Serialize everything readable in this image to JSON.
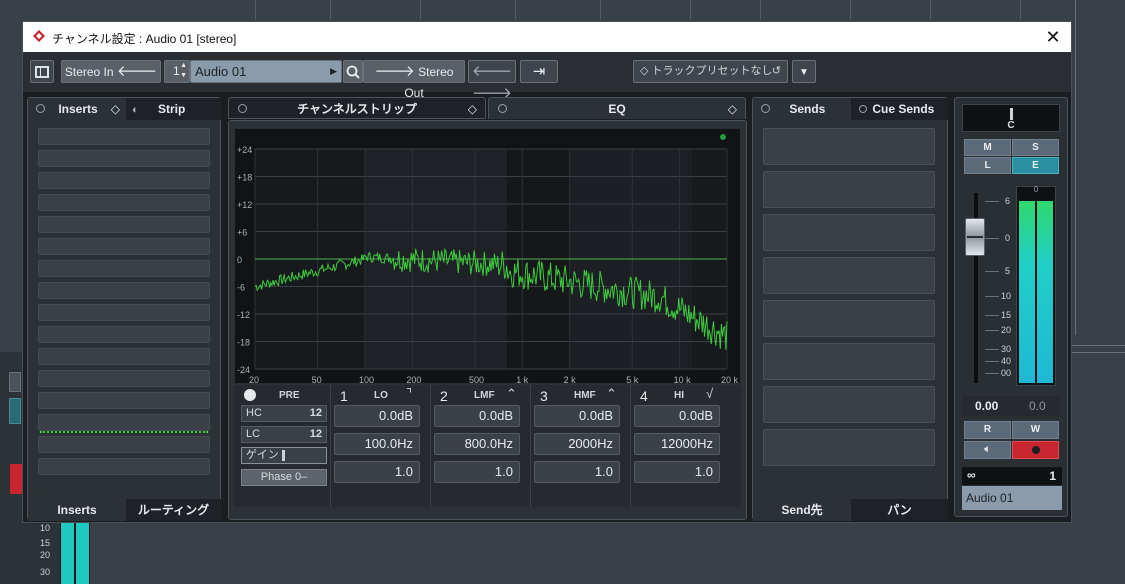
{
  "window": {
    "title": "チャンネル設定 : Audio 01 [stereo]"
  },
  "toolbar": {
    "stereo_in": "Stereo In",
    "channel_num": "1",
    "channel_name": "Audio 01",
    "stereo_out": "Stereo Out",
    "preset": "トラックプリセットなし"
  },
  "left_panel": {
    "tab_inserts": "Inserts",
    "tab_strip": "Strip",
    "bottom_inserts": "Inserts",
    "bottom_routing": "ルーティング"
  },
  "center_panel": {
    "tab_channel_strip": "チャンネルストリップ",
    "tab_eq": "EQ"
  },
  "eq_graph": {
    "y_labels": [
      "+24",
      "+18",
      "+12",
      "+6",
      "0",
      "-6",
      "-12",
      "-18",
      "-24"
    ],
    "x_labels": [
      "20",
      "50",
      "100",
      "200",
      "500",
      "1 k",
      "2 k",
      "5 k",
      "10 k",
      "20 k"
    ]
  },
  "eq_controls": {
    "pre": "PRE",
    "hc": "HC",
    "lc": "LC",
    "gain": "ゲイン",
    "phase": "Phase 0–",
    "bands": [
      {
        "num": "1",
        "label": "LO",
        "gain": "0.0dB",
        "freq": "100.0Hz",
        "q": "1.0"
      },
      {
        "num": "2",
        "label": "LMF",
        "gain": "0.0dB",
        "freq": "800.0Hz",
        "q": "1.0"
      },
      {
        "num": "3",
        "label": "HMF",
        "gain": "0.0dB",
        "freq": "2000Hz",
        "q": "1.0"
      },
      {
        "num": "4",
        "label": "HI",
        "gain": "0.0dB",
        "freq": "12000Hz",
        "q": "1.0"
      }
    ]
  },
  "sends_panel": {
    "tab_sends": "Sends",
    "tab_cue_sends": "Cue Sends",
    "bottom_send_dest": "Send先",
    "bottom_pan": "パン"
  },
  "fader_panel": {
    "pan_value": "C",
    "btn_m": "M",
    "btn_s": "S",
    "btn_l": "L",
    "btn_e": "E",
    "scale": [
      "6",
      "0",
      "5",
      "10",
      "15",
      "20",
      "30",
      "40",
      "00"
    ],
    "meter_top": "0",
    "volume": "0.00",
    "meter_peak": "0.0",
    "btn_r": "R",
    "btn_w": "W",
    "link_num": "1",
    "channel_name": "Audio 01"
  },
  "background": {
    "meter_scale": [
      "10",
      "15",
      "20",
      "30"
    ]
  },
  "colors": {
    "accent": "#1fd0c8",
    "record": "#d0202a",
    "eq_curve": "#3ec83e"
  }
}
